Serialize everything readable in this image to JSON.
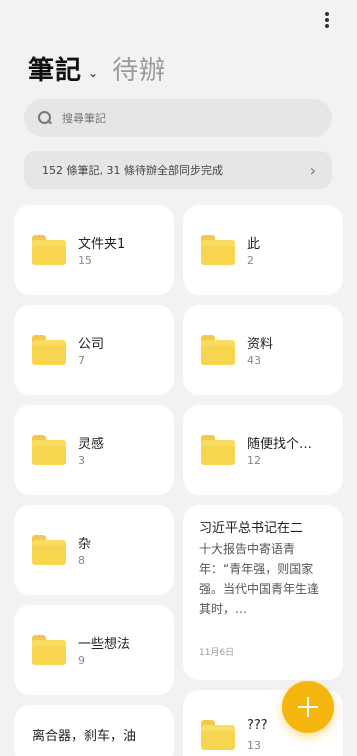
{
  "header": {
    "tab_active": "筆記",
    "tab_inactive": "待辦"
  },
  "search": {
    "placeholder": "搜尋筆記"
  },
  "sync": {
    "text": "152 條筆記, 31 條待辦全部同步完成"
  },
  "folders": [
    {
      "name": "文件夹1",
      "count": "15"
    },
    {
      "name": "此",
      "count": "2"
    },
    {
      "name": "公司",
      "count": "7"
    },
    {
      "name": "资料",
      "count": "43"
    },
    {
      "name": "灵感",
      "count": "3"
    },
    {
      "name": "随便找个…",
      "count": "12"
    },
    {
      "name": "杂",
      "count": "8"
    },
    {
      "name": "一些想法",
      "count": "9"
    },
    {
      "name": "???",
      "count": "13"
    }
  ],
  "note": {
    "title": "习近平总书记在二",
    "body": "十大报告中寄语青年：“青年强，则国家强。当代中国青年生逢其时，…",
    "date": "11月6日"
  },
  "partial_note": {
    "text": "离合器，刹车，油"
  },
  "icons": {
    "more": "more-vert-icon",
    "search": "search-icon",
    "folder": "folder-icon",
    "add": "plus-icon"
  },
  "colors": {
    "accent": "#f5b60f",
    "folder": "#f7d54f"
  }
}
